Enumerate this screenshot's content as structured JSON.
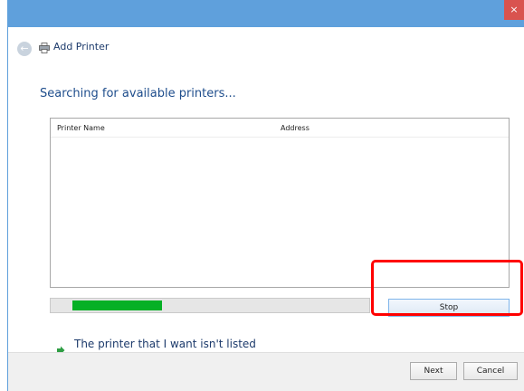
{
  "window": {
    "close_glyph": "×"
  },
  "nav": {
    "title": "Add Printer"
  },
  "heading": "Searching for available printers...",
  "list": {
    "columns": [
      "Printer Name",
      "Address"
    ]
  },
  "progress": {
    "fill_fraction": 0.28,
    "color": "#06b025"
  },
  "buttons": {
    "stop": "Stop",
    "next": "Next",
    "cancel": "Cancel"
  },
  "link": {
    "text": "The printer that I want isn't listed"
  },
  "colors": {
    "titlebar": "#5fa0dc",
    "highlight": "#ff0000",
    "heading": "#1e4d8c"
  }
}
